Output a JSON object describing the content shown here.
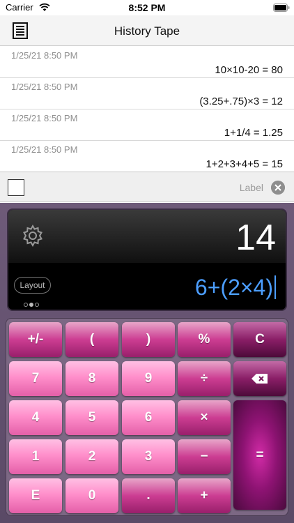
{
  "status_bar": {
    "carrier": "Carrier",
    "time": "8:52 PM"
  },
  "nav": {
    "title": "History Tape"
  },
  "history": [
    {
      "time": "1/25/21 8:50 PM",
      "expr": "10×10-20 = 80"
    },
    {
      "time": "1/25/21 8:50 PM",
      "expr": "(3.25+.75)×3 = 12"
    },
    {
      "time": "1/25/21 8:50 PM",
      "expr": "1+1/4 = 1.25"
    },
    {
      "time": "1/25/21 8:50 PM",
      "expr": "1+2+3+4+5 = 15"
    }
  ],
  "label_bar": {
    "placeholder": "Label"
  },
  "display": {
    "result": "14",
    "expression": "6+(2×4)",
    "layout_label": "Layout"
  },
  "keys": {
    "plus_minus": "+/-",
    "open_paren": "(",
    "close_paren": ")",
    "percent": "%",
    "clear": "C",
    "seven": "7",
    "eight": "8",
    "nine": "9",
    "divide": "÷",
    "four": "4",
    "five": "5",
    "six": "6",
    "multiply": "×",
    "one": "1",
    "two": "2",
    "three": "3",
    "minus": "−",
    "equals": "=",
    "exp": "E",
    "zero": "0",
    "decimal": ".",
    "plus": "+"
  },
  "icons": {
    "wifi": "wifi-icon",
    "battery": "battery-icon",
    "document": "document-icon",
    "clear": "clear-icon",
    "gear": "gear-icon",
    "backspace": "backspace-icon"
  },
  "colors": {
    "accent": "#4c9eff",
    "key_light": "#ff8fcb",
    "key_mid": "#cc3d92",
    "key_dark": "#8a1e67",
    "body": "#6e5a79"
  }
}
